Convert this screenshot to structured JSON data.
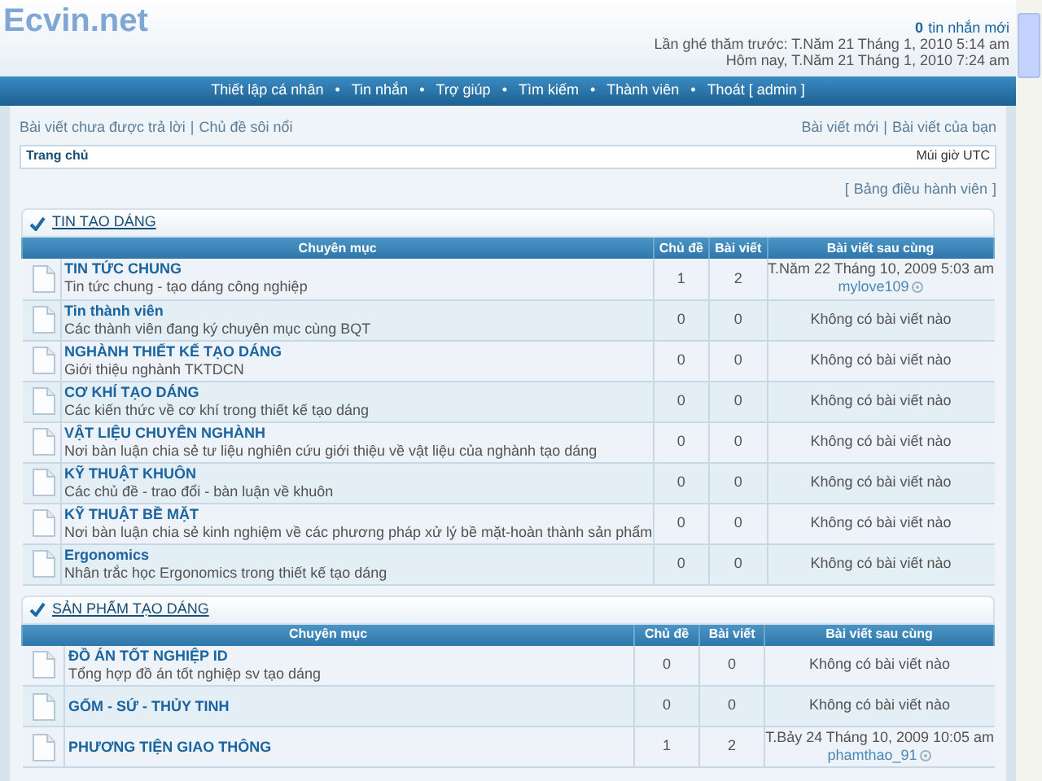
{
  "header": {
    "logo": "Ecvin.net",
    "new_messages_count": "0",
    "new_messages_label": "tin nhắn mới",
    "last_visit": "Lần ghé thăm trước: T.Năm 21 Tháng 1, 2010 5:14 am",
    "today": "Hôm nay, T.Năm 21 Tháng 1, 2010 7:24 am"
  },
  "nav": [
    "Thiết lập cá nhân",
    "Tin nhắn",
    "Trợ giúp",
    "Tìm kiếm",
    "Thành viên",
    "Thoát [ admin ]"
  ],
  "nav_separator": "•",
  "quick_links_left": [
    "Bài viết chưa được trả lời",
    "Chủ đề sôi nổi"
  ],
  "quick_links_right": [
    "Bài viết mới",
    "Bài viết của bạn"
  ],
  "link_separator": "|",
  "breadcrumb": {
    "home": "Trang chủ",
    "timezone": "Múi giờ UTC"
  },
  "moderator_panel": {
    "open": "[",
    "label": "Bảng điều hành viên",
    "close": "]"
  },
  "sections": [
    {
      "title": "TIN TẠO DÁNG",
      "columns": [
        "Chuyên mục",
        "Chủ đề",
        "Bài viết",
        "Bài viết sau cùng"
      ],
      "forums": [
        {
          "title": "TIN TỨC CHUNG",
          "description": "Tin tức chung - tạo dáng công nghiệp",
          "topics": "1",
          "posts": "2",
          "last_post": {
            "kind": "post",
            "date": "T.Năm 22 Tháng 10, 2009 5:03 am",
            "author": "mylove109"
          }
        },
        {
          "title": "Tin thành viên",
          "description": "Các thành viên đang ký chuyên mục cùng BQT",
          "topics": "0",
          "posts": "0",
          "last_post": {
            "kind": "none",
            "text": "Không có bài viết nào"
          }
        },
        {
          "title": "NGHÀNH THIẾT KẾ TẠO DÁNG",
          "description": "Giới thiệu nghành TKTDCN",
          "topics": "0",
          "posts": "0",
          "last_post": {
            "kind": "none",
            "text": "Không có bài viết nào"
          }
        },
        {
          "title": "CƠ KHÍ TẠO DÁNG",
          "description": "Các kiến thức về cơ khí trong thiết kế tạo dáng",
          "topics": "0",
          "posts": "0",
          "last_post": {
            "kind": "none",
            "text": "Không có bài viết nào"
          }
        },
        {
          "title": "VẬT LIỆU CHUYÊN NGHÀNH",
          "description": "Nơi bàn luận chia sẻ tư liệu nghiên cứu giới thiệu về vật liệu của nghành tạo dáng",
          "topics": "0",
          "posts": "0",
          "last_post": {
            "kind": "none",
            "text": "Không có bài viết nào"
          }
        },
        {
          "title": "KỸ THUẬT KHUÔN",
          "description": "Các chủ đề - trao đổi - bàn luận về khuôn",
          "topics": "0",
          "posts": "0",
          "last_post": {
            "kind": "none",
            "text": "Không có bài viết nào"
          }
        },
        {
          "title": "KỸ THUẬT BỀ MẶT",
          "description": "Nơi bàn luận chia sẻ kinh nghiệm về các phương pháp xử lý bề mặt-hoàn thành sản phẩm",
          "topics": "0",
          "posts": "0",
          "last_post": {
            "kind": "none",
            "text": "Không có bài viết nào"
          }
        },
        {
          "title": "Ergonomics",
          "description": "Nhân trắc học Ergonomics trong thiết kế tạo dáng",
          "topics": "0",
          "posts": "0",
          "last_post": {
            "kind": "none",
            "text": "Không có bài viết nào"
          }
        }
      ]
    },
    {
      "title": "SẢN PHẨM TẠO DÁNG",
      "columns": [
        "Chuyên mục",
        "Chủ đề",
        "Bài viết",
        "Bài viết sau cùng"
      ],
      "forums": [
        {
          "title": "ĐỒ ÁN TỐT NGHIỆP ID",
          "description": "Tổng hợp đồ án tốt nghiệp sv tạo dáng",
          "topics": "0",
          "posts": "0",
          "last_post": {
            "kind": "none",
            "text": "Không có bài viết nào"
          }
        },
        {
          "title": "GỐM - SỨ - THỦY TINH",
          "topics": "0",
          "posts": "0",
          "last_post": {
            "kind": "none",
            "text": "Không có bài viết nào"
          }
        },
        {
          "title": "PHƯƠNG TIỆN GIAO THÔNG",
          "topics": "1",
          "posts": "2",
          "last_post": {
            "kind": "post",
            "date": "T.Bảy 24 Tháng 10, 2009 10:05 am",
            "author": "phamthao_91"
          }
        }
      ]
    }
  ]
}
